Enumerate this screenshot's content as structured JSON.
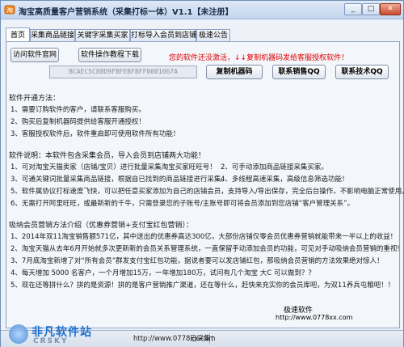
{
  "window": {
    "title": "淘宝高质量客户营销系统（采集打标一体）V1.1【未注册】",
    "min_glyph": "_",
    "max_glyph": "□",
    "close_glyph": "✕"
  },
  "tabs": [
    "首页",
    "采集商品链接",
    "关键字采集买家",
    "打标导入会员到店铺",
    "极速公告"
  ],
  "toolbar": {
    "visit_site": "访问软件官网",
    "tutorial_download": "软件操作教程下载",
    "notice": "您的软件还没激活，↓↓复制机器码发给客服授权软件！",
    "machine_code": "BCAEC5C88D9FBFEBFBFF0001067A",
    "copy_code": "复制机器码",
    "qq_sales": "联系销售QQ",
    "qq_tech": "联系技术QQ"
  },
  "sections": {
    "activation_heading": "软件开通方法：",
    "activation_steps": [
      "1、需要订购软件的客户，请联系客服购买。",
      "2、购买后复制机器码提供给客服开通授权！",
      "3、客服授权软件后，软件重启即可使用软件所有功能！"
    ],
    "features_heading": "软件说明：本软件包含采集会员，导入会员到店铺两大功能！",
    "features": [
      "1、可对淘宝天猫卖家（店铺/宝贝）进行批量采集淘宝买家旺旺号！",
      "3、可通关键词批量采集商品链接，根据自已找到的商品链接进行采集。",
      "5、软件属协议打标速度飞快，可以把任意买家添加为自己的店铺会员，支持导入/导出保存，完全后台操作，不影响电脑正常使用。",
      "6、无需打开阿里旺旺，或最新新的千牛，只需登录您的子账号/主账号即可将会员添加到您店铺“客户管理关系”。"
    ],
    "features_right": [
      "2、可手动添加商品链接采集买家。",
      "4、多线程高速采集，高级信息筛选功能！"
    ],
    "marketing_heading": "吸纳会员营销方法介绍（优惠券营销+支付宝红包营销）：",
    "marketing": [
      "1、2014年双11淘宝销售额571亿，其中送出的优惠券高达300亿，大部份店铺仅零会员优惠券营销就能带来一半以上的收益！",
      "2、淘宝天猫从去年6月开始就多次更新新的会员关系管理系统，一直保留手动添加会员的功能，可见对手动吸纳会员营销的重视!",
      "3、7月底淘宝新增了对“所有会员”群发支付宝红包功能，据说者要可以发店铺红包，那吸纳会员营销的方法效果绝对惊人！",
      "4、每天增加 5000 名客户，一个月增加15万，一年增加180万，试问有几个淘宝 大C 可以做到？？",
      "5、现在还等拼什么？拼的是资源！拼的是客户营销推广渠道，还在等什么，赶快来充实你的会员库吧，为双11养兵屯粮吧！！"
    ],
    "footer_name": "极速软件",
    "footer_url": "http://www.0778xx.com"
  },
  "statusbar": {
    "url": "http://www.0778xx.com",
    "collected": "已采集："
  },
  "watermark": {
    "main": "非凡软件站",
    "sub": "CRSKY"
  },
  "colors": {
    "notice": "#e00000",
    "window_border": "#6f8fb8",
    "panel_bg": "#f3f6fa"
  }
}
